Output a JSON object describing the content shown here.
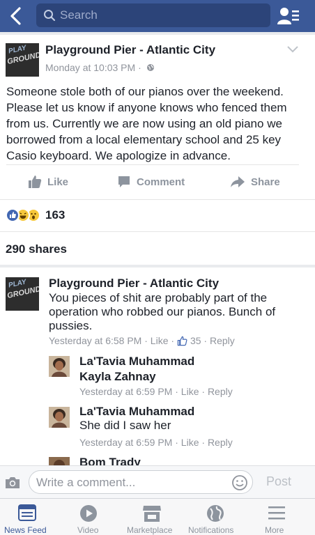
{
  "header": {
    "search_placeholder": "Search"
  },
  "post": {
    "author": "Playground Pier - Atlantic City",
    "time": "Monday at 10:03 PM ·",
    "avatar_text_top": "PLAY",
    "avatar_text_bottom": "GROUND",
    "text": "Someone stole both of our pianos over the weekend. Please let us know if anyone knows who fenced them from us. Currently we are now using an old piano we borrowed from a local elementary school and 25 key Casio keyboard. We apologize in advance.",
    "actions": {
      "like": "Like",
      "comment": "Comment",
      "share": "Share"
    },
    "reaction_count": "163",
    "shares": "290 shares"
  },
  "comments": [
    {
      "author": "Playground Pier - Atlantic City",
      "text_line1": "You pieces of shit are probably part of the",
      "text_line2": "operation who robbed our pianos. Bunch of",
      "text_line3": "pussies.",
      "time": "Yesterday at 6:58 PM",
      "like": "Like",
      "like_count": "35",
      "reply": "Reply"
    },
    {
      "author": "La'Tavia Muhammad",
      "text": "Kayla Zahnay",
      "time": "Yesterday at 6:59 PM",
      "like": "Like",
      "reply": "Reply"
    },
    {
      "author": "La'Tavia Muhammad",
      "text": "She did I saw her",
      "time": "Yesterday at 6:59 PM",
      "like": "Like",
      "reply": "Reply"
    },
    {
      "author": "Bom Trady"
    }
  ],
  "composer": {
    "placeholder": "Write a comment...",
    "post_label": "Post"
  },
  "tabs": [
    {
      "label": "News Feed"
    },
    {
      "label": "Video"
    },
    {
      "label": "Marketplace"
    },
    {
      "label": "Notifications"
    },
    {
      "label": "More"
    }
  ],
  "colors": {
    "brand": "#3b5998",
    "like_blue": "#4267b2",
    "haha_yellow": "#f7c83c"
  }
}
